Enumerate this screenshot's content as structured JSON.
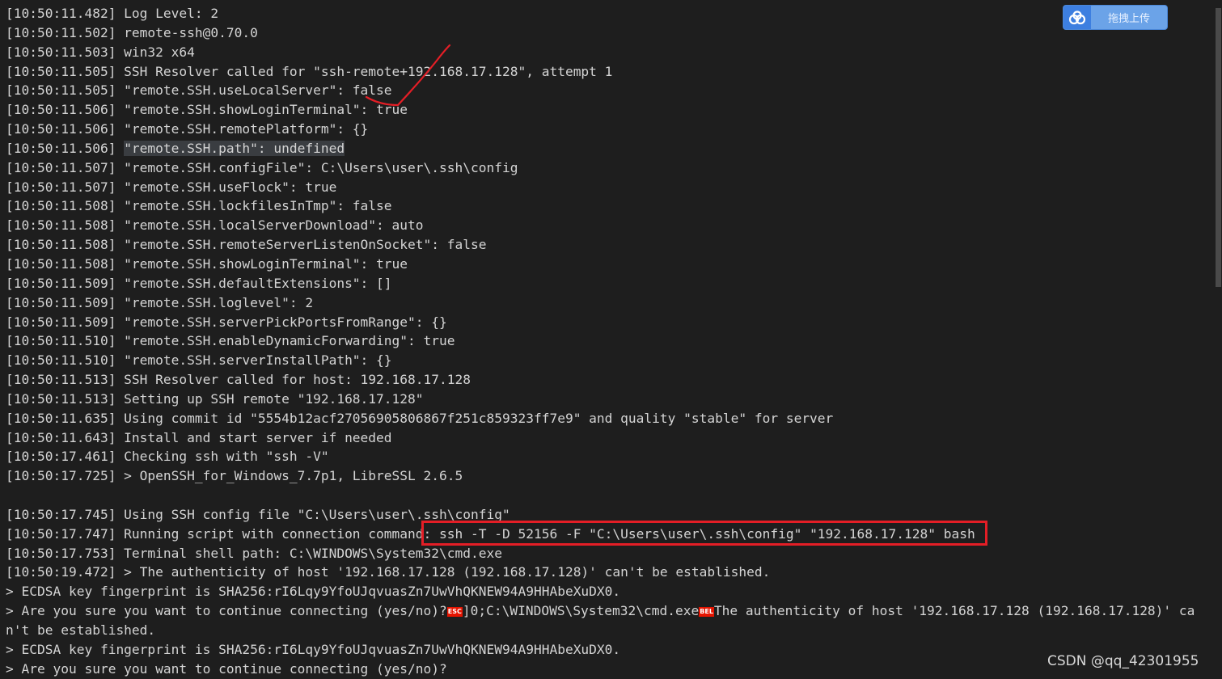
{
  "log_lines": [
    "[10:50:11.482] Log Level: 2",
    "[10:50:11.502] remote-ssh@0.70.0",
    "[10:50:11.503] win32 x64",
    "[10:50:11.505] SSH Resolver called for \"ssh-remote+192.168.17.128\", attempt 1",
    "[10:50:11.505] \"remote.SSH.useLocalServer\": false",
    "[10:50:11.506] \"remote.SSH.showLoginTerminal\": true",
    "[10:50:11.506] \"remote.SSH.remotePlatform\": {}",
    "[10:50:11.507] \"remote.SSH.configFile\": C:\\Users\\user\\.ssh\\config",
    "[10:50:11.507] \"remote.SSH.useFlock\": true",
    "[10:50:11.508] \"remote.SSH.lockfilesInTmp\": false",
    "[10:50:11.508] \"remote.SSH.localServerDownload\": auto",
    "[10:50:11.508] \"remote.SSH.remoteServerListenOnSocket\": false",
    "[10:50:11.508] \"remote.SSH.showLoginTerminal\": true",
    "[10:50:11.509] \"remote.SSH.defaultExtensions\": []",
    "[10:50:11.509] \"remote.SSH.loglevel\": 2",
    "[10:50:11.509] \"remote.SSH.serverPickPortsFromRange\": {}",
    "[10:50:11.510] \"remote.SSH.enableDynamicForwarding\": true",
    "[10:50:11.510] \"remote.SSH.serverInstallPath\": {}",
    "[10:50:11.513] SSH Resolver called for host: 192.168.17.128",
    "[10:50:11.513] Setting up SSH remote \"192.168.17.128\"",
    "[10:50:11.635] Using commit id \"5554b12acf27056905806867f251c859323ff7e9\" and quality \"stable\" for server",
    "[10:50:11.643] Install and start server if needed",
    "[10:50:17.461] Checking ssh with \"ssh -V\"",
    "[10:50:17.725] > OpenSSH_for_Windows_7.7p1, LibreSSL 2.6.5",
    "",
    "[10:50:17.745] Using SSH config file \"C:\\Users\\user\\.ssh\\config\"",
    "[10:50:17.753] Terminal shell path: C:\\WINDOWS\\System32\\cmd.exe",
    "[10:50:19.472] > The authenticity of host '192.168.17.128 (192.168.17.128)' can't be established.",
    "> ECDSA key fingerprint is SHA256:rI6Lqy9YfoUJqvuasZn7UwVhQKNEW94A9HHAbeXuDX0.",
    "> ECDSA key fingerprint is SHA256:rI6Lqy9YfoUJqvuasZn7UwVhQKNEW94A9HHAbeXuDX0.",
    "> Are you sure you want to continue connecting (yes/no)?"
  ],
  "highlighted_line": {
    "timestamp": "[10:50:11.506] ",
    "text": "\"remote.SSH.path\": undefined"
  },
  "running_script": {
    "prefix": "[10:50:17.747] Running script with connection command: ",
    "command": "ssh -T -D 52156 -F \"C:\\Users\\user\\.ssh\\config\" \"192.168.17.128\" bash"
  },
  "prompt_line": {
    "part1": "> Are you sure you want to continue connecting (yes/no)?",
    "esc": "ESC",
    "part2": "]0;C:\\WINDOWS\\System32\\cmd.exe",
    "bel": "BEL",
    "part3": "The authenticity of host '192.168.17.128 (192.168.17.128)' can't be established."
  },
  "upload_button": {
    "label": "拖拽上传",
    "icon": "cloud-icon",
    "color": "#6ba3e8"
  },
  "watermark": "CSDN @qq_42301955",
  "annotation_color": "#e41e26"
}
